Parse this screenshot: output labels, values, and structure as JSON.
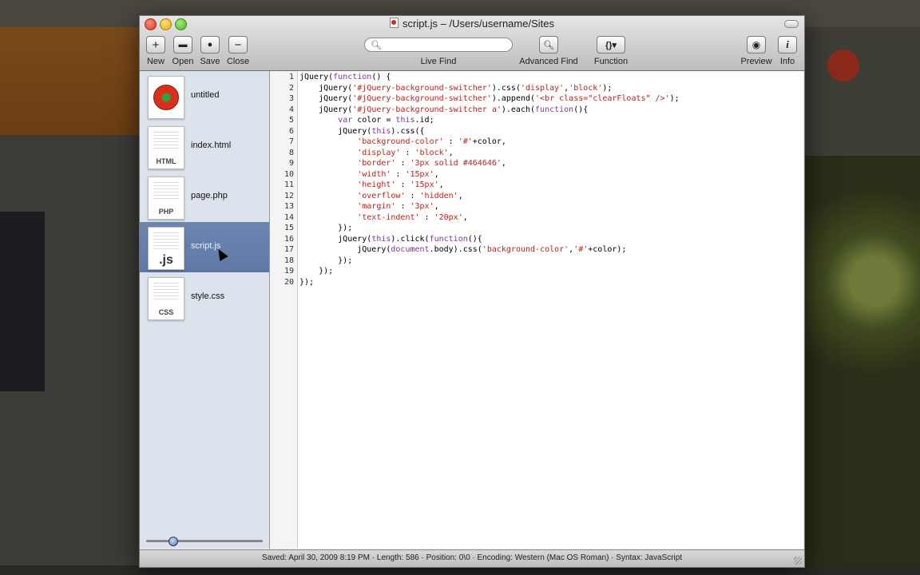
{
  "window": {
    "title": "script.js – /Users/username/Sites"
  },
  "toolbar": {
    "new": {
      "label": "New",
      "glyph": "+"
    },
    "open": {
      "label": "Open",
      "glyph": "▬"
    },
    "save": {
      "label": "Save",
      "glyph": "●"
    },
    "close": {
      "label": "Close",
      "glyph": "−"
    },
    "live_find": {
      "label": "Live Find",
      "placeholder": ""
    },
    "advanced_find": {
      "label": "Advanced Find",
      "glyph": "🔍"
    },
    "function": {
      "label": "Function",
      "glyph": "{}▾"
    },
    "preview": {
      "label": "Preview",
      "glyph": "◉"
    },
    "info": {
      "label": "Info",
      "glyph": "i"
    }
  },
  "sidebar": {
    "files": [
      {
        "name": "untitled",
        "ext": "",
        "icon": "tomato-icon"
      },
      {
        "name": "index.html",
        "ext": "HTML",
        "icon": "html-file-icon"
      },
      {
        "name": "page.php",
        "ext": "PHP",
        "icon": "php-file-icon"
      },
      {
        "name": "script.js",
        "ext": ".js",
        "icon": "js-file-icon",
        "selected": true
      },
      {
        "name": "style.css",
        "ext": "CSS",
        "icon": "css-file-icon"
      }
    ],
    "zoom_slider": 0.2
  },
  "editor": {
    "line_numbers": [
      "1",
      "2",
      "3",
      "4",
      "5",
      "6",
      "7",
      "8",
      "9",
      "10",
      "11",
      "12",
      "13",
      "14",
      "15",
      "16",
      "17",
      "18",
      "19",
      "20"
    ],
    "lines": [
      "jQuery(function() {",
      "    jQuery('#jQuery-background-switcher').css('display','block');",
      "    jQuery('#jQuery-background-switcher').append('<br class=\"clearFloats\" />');",
      "    jQuery('#jQuery-background-switcher a').each(function(){",
      "        var color = this.id;",
      "        jQuery(this).css({",
      "            'background-color' : '#'+color,",
      "            'display' : 'block',",
      "            'border' : '3px solid #464646',",
      "            'width' : '15px',",
      "            'height' : '15px',",
      "            'overflow' : 'hidden',",
      "            'margin' : '3px',",
      "            'text-indent' : '20px',",
      "        });",
      "        jQuery(this).click(function(){",
      "            jQuery(document.body).css('background-color','#'+color);",
      "        });",
      "    });",
      "});"
    ]
  },
  "status": {
    "text": "Saved: April 30, 2009 8:19 PM  ·  Length: 586  ·  Position: 0\\0  ·  Encoding: Western (Mac OS Roman)  ·  Syntax: JavaScript"
  },
  "colors": {
    "selection": "#6d86b0",
    "string": "#b8261e",
    "keyword": "#7a3a9a"
  }
}
